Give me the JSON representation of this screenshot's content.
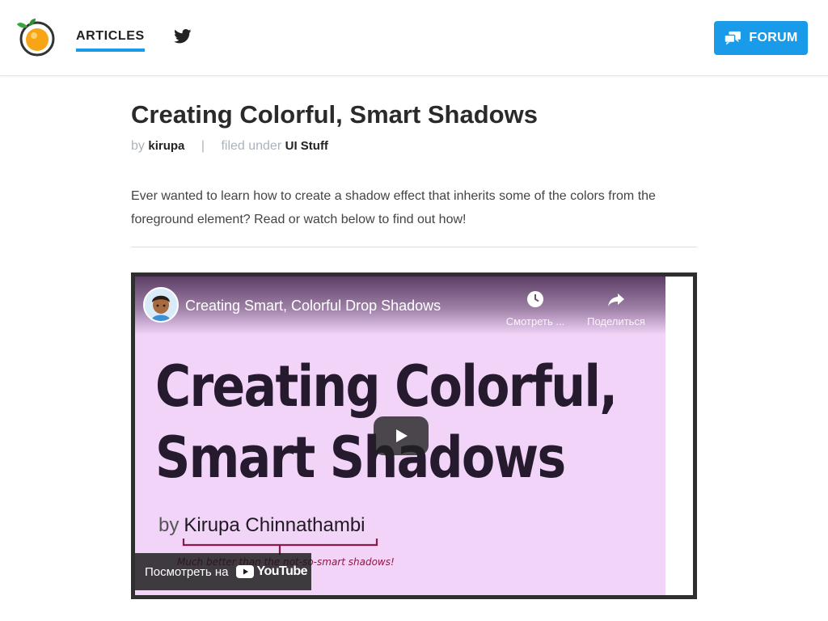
{
  "header": {
    "nav_articles": "ARTICLES",
    "forum_label": "FORUM",
    "accent_color": "#1a9be9",
    "icons": [
      "kirupa-logo",
      "twitter-icon",
      "forum-chat-icon"
    ]
  },
  "article": {
    "title": "Creating Colorful, Smart Shadows",
    "by_label": "by",
    "author": "kirupa",
    "separator": "|",
    "filed_label": "filed under",
    "category": "UI Stuff",
    "intro": "Ever wanted to learn how to create a shadow effect that inherits some of the colors from the foreground element? Read or watch below to find out how!"
  },
  "video": {
    "title": "Creating Smart, Colorful Drop Shadows",
    "watch_later": "Смотреть ...",
    "share": "Поделиться",
    "thumb_line1": "Creating Colorful,",
    "thumb_line2": "Smart Shadows",
    "thumb_by": "by",
    "thumb_author": "Kirupa Chinnathambi",
    "thumb_note": "Much better than the not-so-smart shadows!",
    "watch_on": "Посмотреть на",
    "yt_brand": "YouTube",
    "thumb_bg": "#f2d4f9"
  }
}
